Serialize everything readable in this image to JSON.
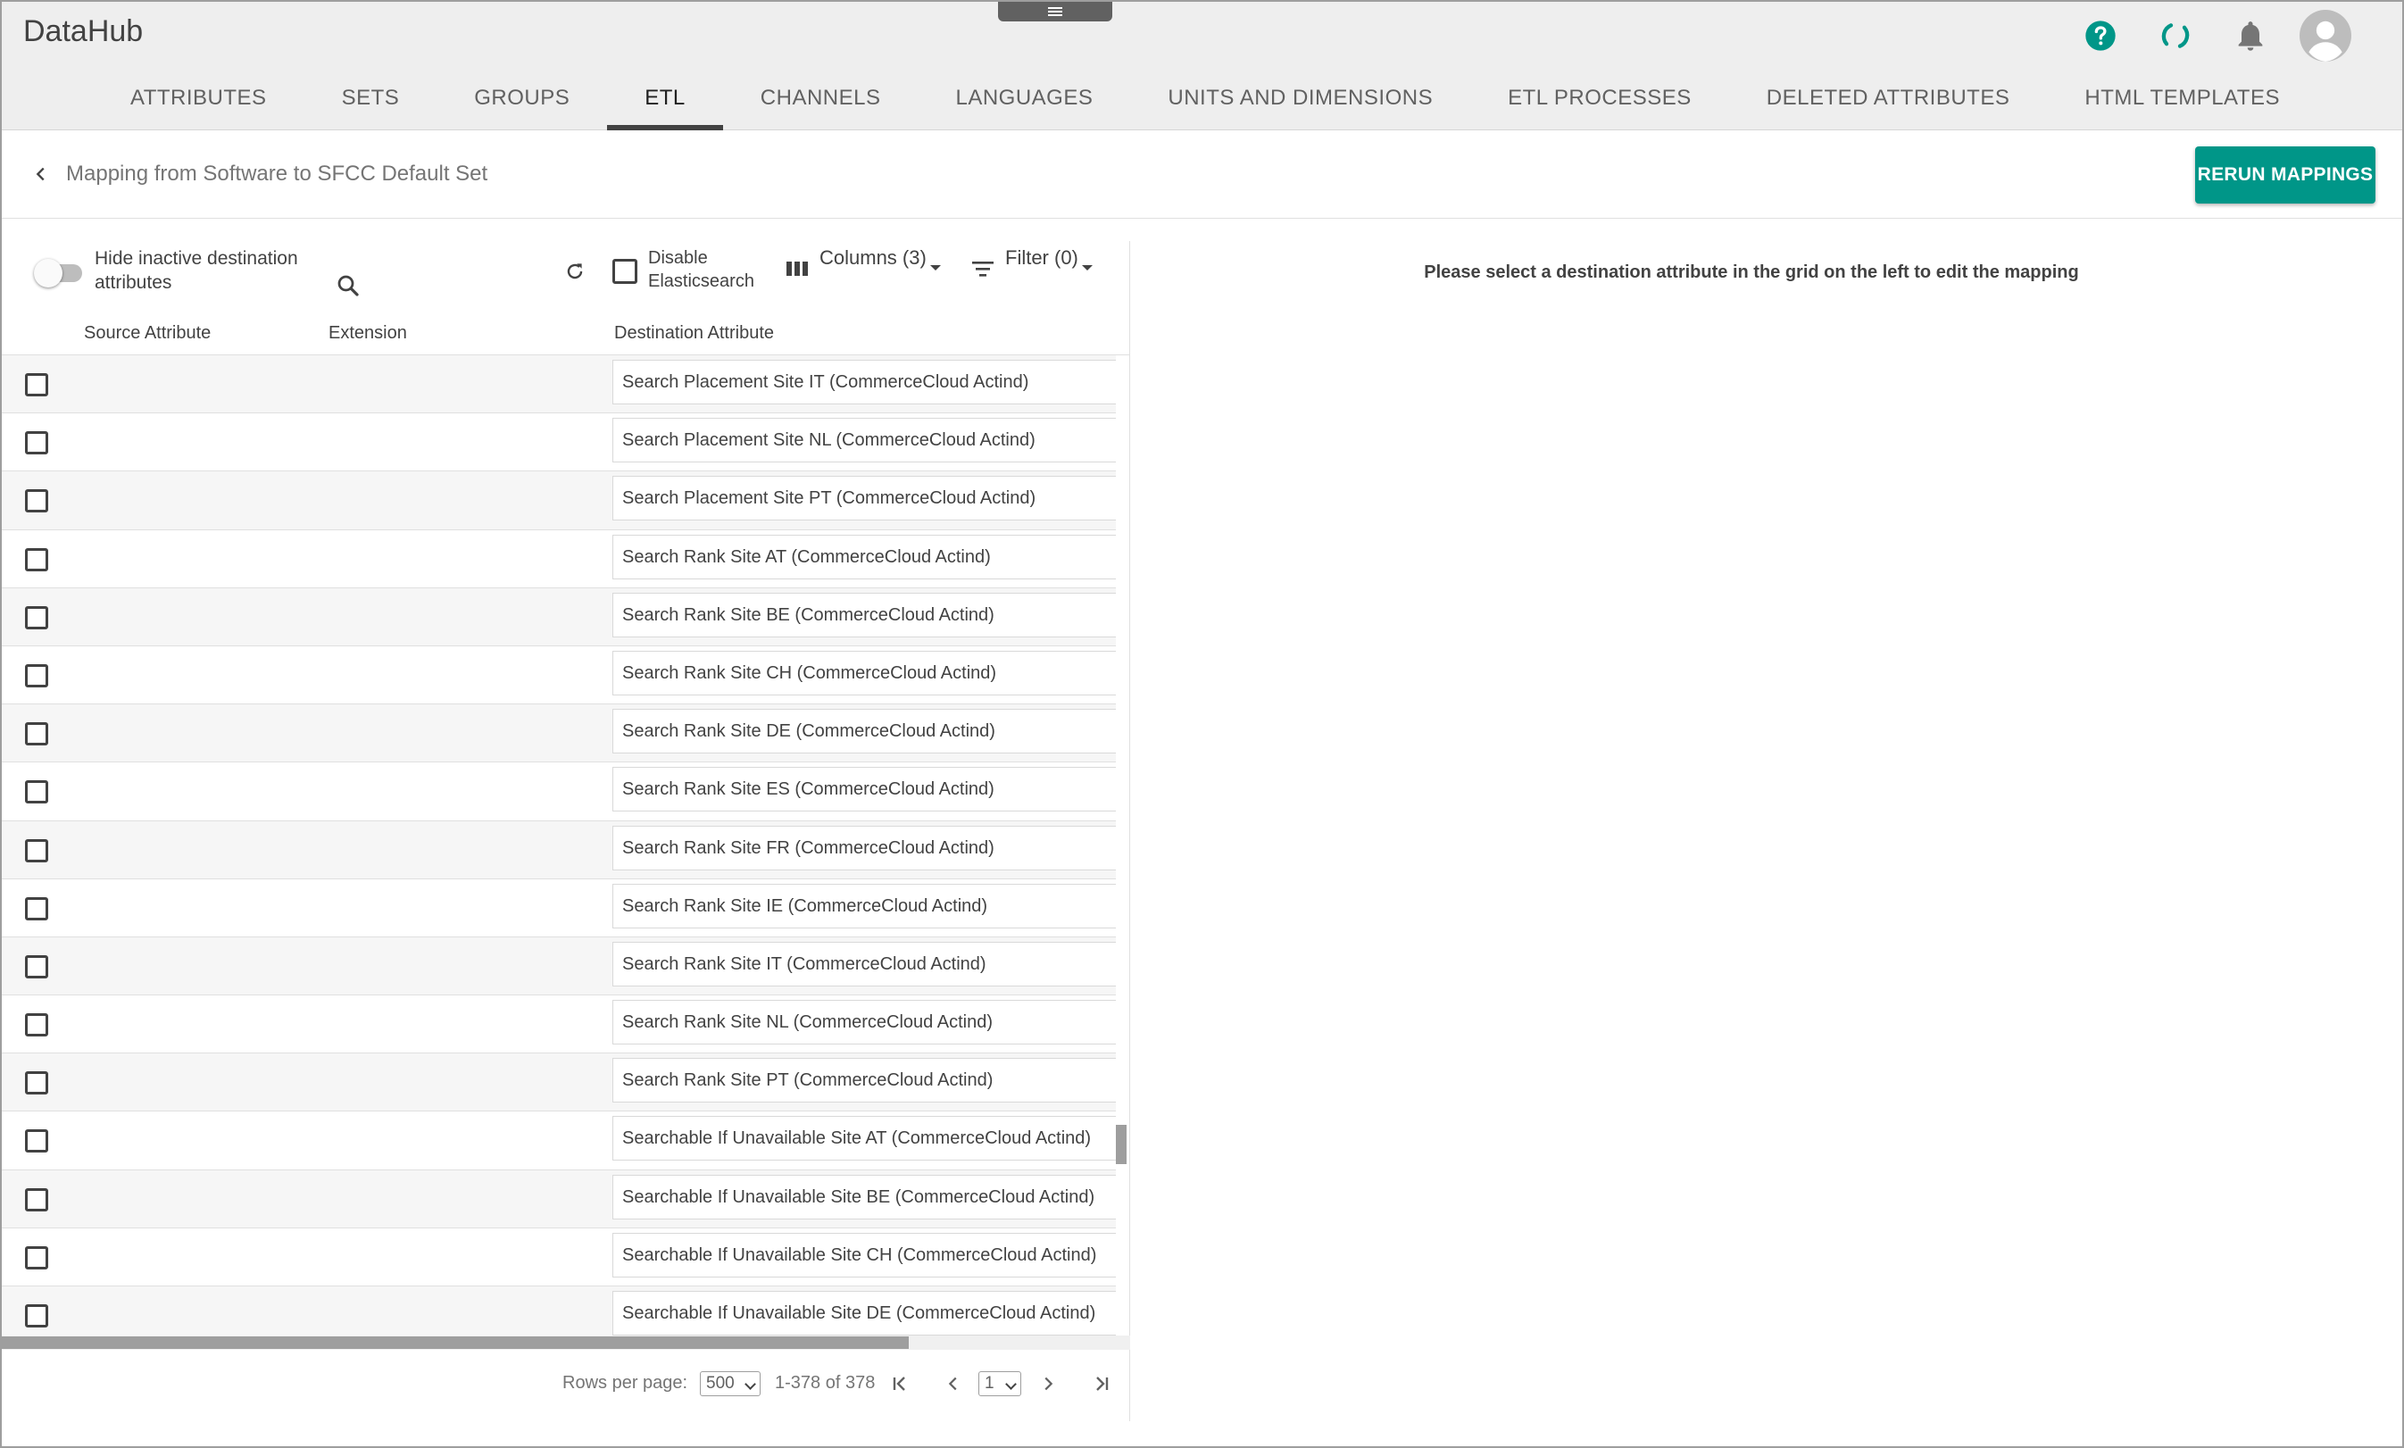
{
  "app": {
    "title": "DataHub"
  },
  "header": {
    "icons": [
      "help-icon",
      "sync-icon",
      "bell-icon",
      "avatar-icon"
    ],
    "accent": "#009688"
  },
  "tabs": [
    {
      "label": "ATTRIBUTES",
      "active": false
    },
    {
      "label": "SETS",
      "active": false
    },
    {
      "label": "GROUPS",
      "active": false
    },
    {
      "label": "ETL",
      "active": true
    },
    {
      "label": "CHANNELS",
      "active": false
    },
    {
      "label": "LANGUAGES",
      "active": false
    },
    {
      "label": "UNITS AND DIMENSIONS",
      "active": false
    },
    {
      "label": "ETL PROCESSES",
      "active": false
    },
    {
      "label": "DELETED ATTRIBUTES",
      "active": false
    },
    {
      "label": "HTML TEMPLATES",
      "active": false
    }
  ],
  "breadcrumb": {
    "title": "Mapping from Software to SFCC Default Set",
    "rerun_label": "RERUN MAPPINGS"
  },
  "toolbar": {
    "hide_inactive_label": "Hide inactive destination attributes",
    "disable_es_label": "Disable Elasticsearch",
    "columns_label": "Columns (3)",
    "filter_label": "Filter (0)"
  },
  "grid": {
    "headers": {
      "source": "Source Attribute",
      "extension": "Extension",
      "destination": "Destination Attribute"
    },
    "rows": [
      "Search Placement Site IT (CommerceCloud Actind)",
      "Search Placement Site NL (CommerceCloud Actind)",
      "Search Placement Site PT (CommerceCloud Actind)",
      "Search Rank Site AT (CommerceCloud Actind)",
      "Search Rank Site BE (CommerceCloud Actind)",
      "Search Rank Site CH (CommerceCloud Actind)",
      "Search Rank Site DE (CommerceCloud Actind)",
      "Search Rank Site ES (CommerceCloud Actind)",
      "Search Rank Site FR (CommerceCloud Actind)",
      "Search Rank Site IE (CommerceCloud Actind)",
      "Search Rank Site IT (CommerceCloud Actind)",
      "Search Rank Site NL (CommerceCloud Actind)",
      "Search Rank Site PT (CommerceCloud Actind)",
      "Searchable If Unavailable Site AT (CommerceCloud Actind)",
      "Searchable If Unavailable Site BE (CommerceCloud Actind)",
      "Searchable If Unavailable Site CH (CommerceCloud Actind)",
      "Searchable If Unavailable Site DE (CommerceCloud Actind)"
    ]
  },
  "pagination": {
    "rows_per_page_label": "Rows per page:",
    "rows_per_page_value": "500",
    "range": "1-378 of 378",
    "page_value": "1"
  },
  "right_panel": {
    "message": "Please select a destination attribute in the grid on the left to edit the mapping"
  }
}
